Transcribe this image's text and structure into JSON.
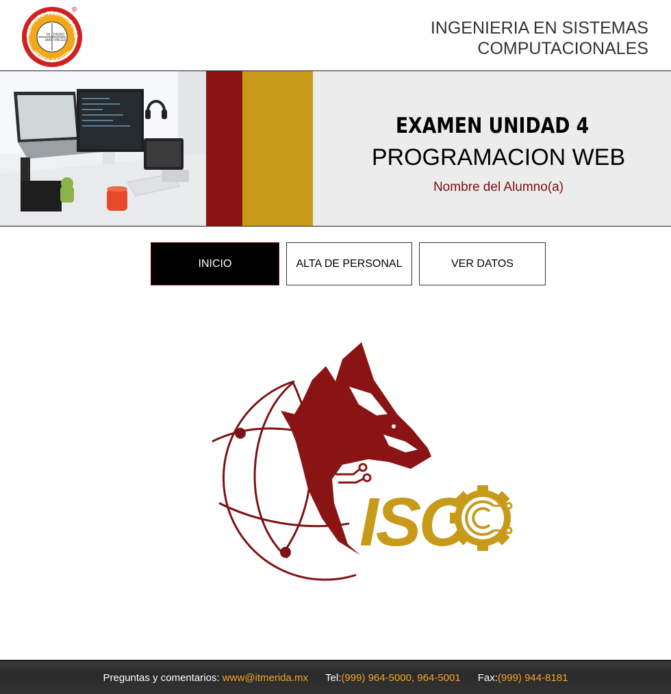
{
  "header": {
    "seal_text_top": "INSTITUTO TECNOLOGICO",
    "seal_text_bottom": "MERIDA YUCATAN",
    "seal_registered": "®",
    "career_line1": "INGENIERIA EN SISTEMAS",
    "career_line2": "COMPUTACIONALES"
  },
  "banner": {
    "exam_title": "EXAMEN UNIDAD 4",
    "subject": "PROGRAMACION WEB",
    "student_label": "Nombre del Alumno(a)"
  },
  "nav": {
    "inicio": "INICIO",
    "alta": "ALTA DE PERSONAL",
    "ver": "VER DATOS"
  },
  "logo": {
    "text": "ISC"
  },
  "footer": {
    "comments_label": "Preguntas y comentarios: ",
    "email": "www@itmerida.mx",
    "tel_label": "Tel:",
    "tel": "(999) 964-5000, 964-5001",
    "fax_label": "Fax:",
    "fax": "(999) 944-8181"
  },
  "colors": {
    "brand_red": "#8a1414",
    "brand_gold": "#c89a1a",
    "footer_accent": "#f5a623"
  }
}
